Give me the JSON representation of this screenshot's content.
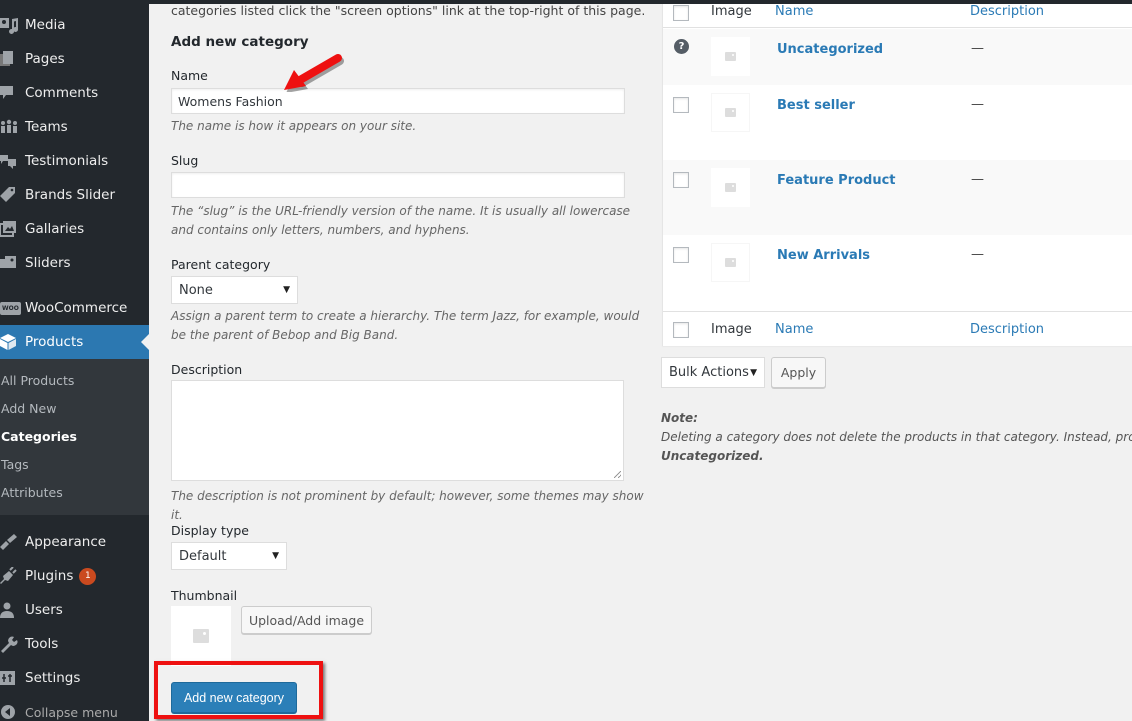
{
  "sidebar": {
    "menu": [
      {
        "label": "Media",
        "icon": "media-icon"
      },
      {
        "label": "Pages",
        "icon": "pages-icon"
      },
      {
        "label": "Comments",
        "icon": "comments-icon"
      },
      {
        "label": "Teams",
        "icon": "teams-icon"
      },
      {
        "label": "Testimonials",
        "icon": "testimonials-icon"
      },
      {
        "label": "Brands Slider",
        "icon": "tag-icon"
      },
      {
        "label": "Gallaries",
        "icon": "gallery-icon"
      },
      {
        "label": "Sliders",
        "icon": "sliders-icon"
      },
      {
        "label": "WooCommerce",
        "icon": "woocommerce-icon"
      },
      {
        "label": "Products",
        "icon": "products-icon"
      }
    ],
    "products_submenu": [
      {
        "label": "All Products"
      },
      {
        "label": "Add New"
      },
      {
        "label": "Categories"
      },
      {
        "label": "Tags"
      },
      {
        "label": "Attributes"
      }
    ],
    "menu_bottom": [
      {
        "label": "Appearance",
        "icon": "appearance-icon"
      },
      {
        "label": "Plugins",
        "icon": "plugins-icon",
        "badge": "1"
      },
      {
        "label": "Users",
        "icon": "users-icon"
      },
      {
        "label": "Tools",
        "icon": "tools-icon"
      },
      {
        "label": "Settings",
        "icon": "settings-icon"
      }
    ],
    "collapse_label": "Collapse menu",
    "woo_icon_text": "WOO",
    "active_color": "#2c78b1"
  },
  "form": {
    "intro": "categories listed click the \"screen options\" link at the top-right of this page.",
    "title": "Add new category",
    "name_label": "Name",
    "name_value": "Womens Fashion",
    "name_hint": "The name is how it appears on your site.",
    "slug_label": "Slug",
    "slug_value": "",
    "slug_hint": "The “slug” is the URL-friendly version of the name. It is usually all lowercase and contains only letters, numbers, and hyphens.",
    "parent_label": "Parent category",
    "parent_value": "None",
    "parent_hint": "Assign a parent term to create a hierarchy. The term Jazz, for example, would be the parent of Bebop and Big Band.",
    "description_label": "Description",
    "description_value": "",
    "description_hint": "The description is not prominent by default; however, some themes may show it.",
    "display_type_label": "Display type",
    "display_type_value": "Default",
    "thumbnail_label": "Thumbnail",
    "upload_button": "Upload/Add image",
    "submit_button": "Add new category"
  },
  "table": {
    "headers": {
      "image": "Image",
      "name": "Name",
      "description": "Description"
    },
    "rows": [
      {
        "name": "Uncategorized",
        "description": "—",
        "default": true
      },
      {
        "name": "Best seller",
        "description": "—"
      },
      {
        "name": "Feature Product",
        "description": "—"
      },
      {
        "name": "New Arrivals",
        "description": "—"
      }
    ],
    "help_glyph": "?"
  },
  "bulk": {
    "select_value": "Bulk Actions",
    "apply_label": "Apply"
  },
  "note": {
    "title": "Note:",
    "text": "Deleting a category does not delete the products in that category. Instead, products t",
    "strong": "Uncategorized."
  },
  "annotations": {
    "highlight_color": "#ee1111"
  },
  "dropdown_arrow": "▼"
}
